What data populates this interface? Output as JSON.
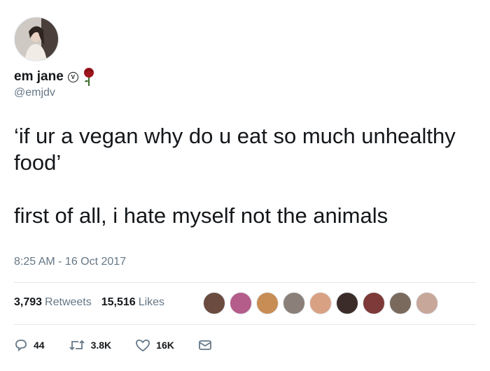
{
  "user": {
    "display_name": "em jane",
    "verified_glyph": "V",
    "handle": "@emjdv",
    "avatar_icon": "user-avatar",
    "emoji_icon": "rose-icon"
  },
  "tweet": {
    "text": "‘if ur a vegan why do u eat so much unhealthy food’\n\nfirst of all, i hate myself not the animals",
    "timestamp": "8:25 AM - 16 Oct 2017"
  },
  "stats": {
    "retweets_count": "3,793",
    "retweets_label": "Retweets",
    "likes_count": "15,516",
    "likes_label": "Likes"
  },
  "likers": [
    "#6b4b3f",
    "#b45c8a",
    "#c88c55",
    "#8a7f79",
    "#d9a184",
    "#3b2c29",
    "#7e3a38",
    "#7a6a5e",
    "#c7a79a"
  ],
  "actions": {
    "replies": "44",
    "retweets": "3.8K",
    "likes": "16K"
  },
  "colors": {
    "text": "#14171a",
    "secondary": "#657786",
    "divider": "#e1e8ed"
  }
}
